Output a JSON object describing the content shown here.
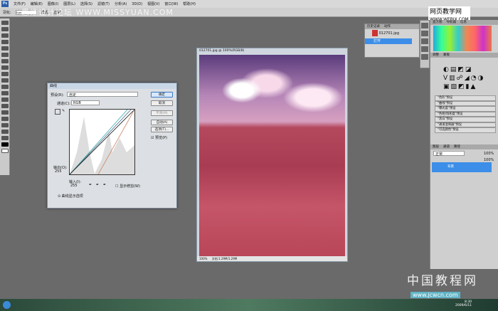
{
  "menubar": {
    "logo": "Ps",
    "items": [
      "文件(F)",
      "编辑(E)",
      "图像(I)",
      "图层(L)",
      "选择(S)",
      "滤镜(T)",
      "分析(A)",
      "3D(D)",
      "视图(V)",
      "窗口(W)",
      "帮助(H)"
    ]
  },
  "optbar": {
    "label1": "羽化:",
    "feather": "0 px",
    "label2": "样式:",
    "style": "正常"
  },
  "watermarks": {
    "top": "思缘设计论坛 WWW.MISSYUAN.COM",
    "right_cn": "网页教学网",
    "right_url": "WWW.WEBJX.COM",
    "bottom_cn": "中国教程网",
    "bottom_url": "www.jcwcn.com"
  },
  "curves": {
    "title": "曲线",
    "preset_label": "预设(R):",
    "preset_value": "自定",
    "channel_label": "通道(C):",
    "channel_value": "RGB",
    "ok": "确定",
    "cancel": "取消",
    "smooth": "平滑(M)",
    "auto": "自动(A)",
    "options": "选项(T)...",
    "preview": "预览(P)",
    "preview_checked": true,
    "output_label": "输出(O):",
    "output_value": "255",
    "input_label": "输入(I):",
    "input_value": "255",
    "show_clipping": "显示修剪(W)",
    "display_options": "曲线显示选项"
  },
  "document": {
    "title": "012701.jpg @ 100%(RGB/8)",
    "zoom": "100%",
    "doc_size": "文档:1.29M/1.29M"
  },
  "history": {
    "tabs": [
      "历史记录",
      "动作"
    ],
    "snapshot": "012701.jpg",
    "items": [
      "打开"
    ]
  },
  "adjustments": {
    "tabs": [
      "调整",
      "蒙版"
    ],
    "presets": [
      "\"色阶\"预设",
      "\"曲线\"预设",
      "\"曝光度\"预设",
      "\"色相/饱和度\"预设",
      "\"黑白\"预设",
      "\"通道混和器\"预设",
      "\"可选颜色\"预设"
    ]
  },
  "histogram_tabs": [
    "直方图",
    "导航器",
    "信息"
  ],
  "layers": {
    "tabs": [
      "图层",
      "通道",
      "路径"
    ],
    "blend_mode": "正常",
    "opacity": "100%",
    "fill": "100%",
    "layer_name": "背景"
  },
  "taskbar": {
    "time": "8:30",
    "date": "2009/6/11"
  }
}
